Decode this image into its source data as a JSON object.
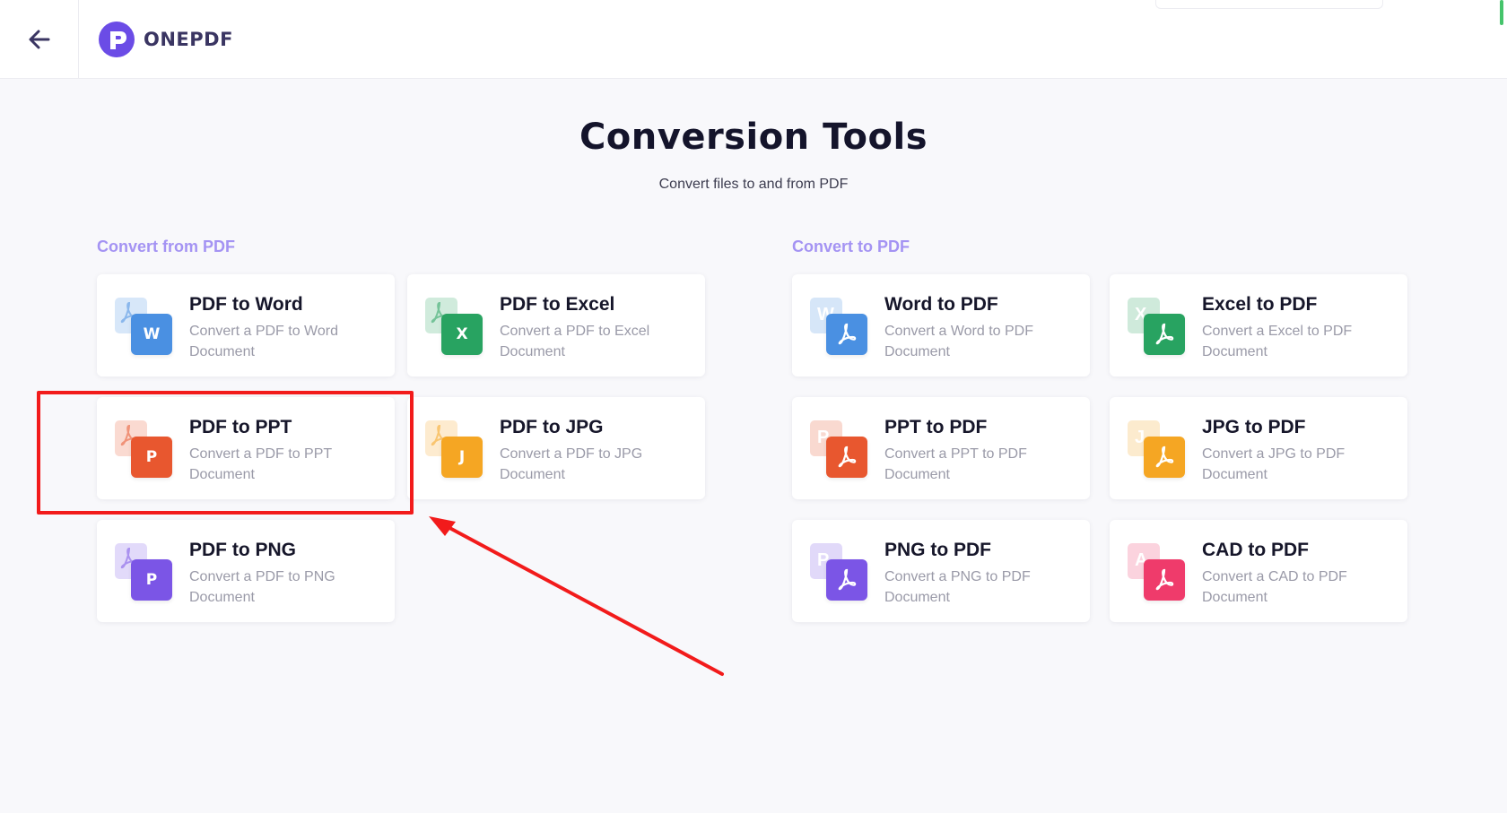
{
  "header": {
    "logo_text": "ONEPDF",
    "brand_color": "#6b4ce6"
  },
  "page": {
    "title": "Conversion Tools",
    "subtitle": "Convert files to and from PDF"
  },
  "sections": {
    "from_pdf": {
      "heading": "Convert from PDF",
      "cards": [
        {
          "title": "PDF to Word",
          "desc": "Convert a PDF to Word Document",
          "glyph": "W",
          "back_icon": "pdf-icon",
          "color": "#4a90e2"
        },
        {
          "title": "PDF to Excel",
          "desc": "Convert a PDF to Excel Document",
          "glyph": "X",
          "back_icon": "pdf-icon",
          "color": "#28a361"
        },
        {
          "title": "PDF to PPT",
          "desc": "Convert a PDF to PPT Document",
          "glyph": "P",
          "back_icon": "pdf-icon",
          "color": "#e8572f"
        },
        {
          "title": "PDF to JPG",
          "desc": "Convert a PDF to JPG Document",
          "glyph": "J",
          "back_icon": "pdf-icon",
          "color": "#f5a623"
        },
        {
          "title": "PDF to PNG",
          "desc": "Convert a PDF to PNG Document",
          "glyph": "P",
          "back_icon": "pdf-icon",
          "color": "#7b55e6"
        }
      ]
    },
    "to_pdf": {
      "heading": "Convert to PDF",
      "cards": [
        {
          "title": "Word to PDF",
          "desc": "Convert a Word to PDF Document",
          "back_glyph": "W",
          "front_icon": "pdf-icon",
          "color": "#4a90e2"
        },
        {
          "title": "Excel to PDF",
          "desc": "Convert a Excel to PDF Document",
          "back_glyph": "X",
          "front_icon": "pdf-icon",
          "color": "#28a361"
        },
        {
          "title": "PPT to PDF",
          "desc": "Convert a PPT to PDF Document",
          "back_glyph": "P",
          "front_icon": "pdf-icon",
          "color": "#e8572f"
        },
        {
          "title": "JPG to PDF",
          "desc": "Convert a JPG to PDF Document",
          "back_glyph": "J",
          "front_icon": "pdf-icon",
          "color": "#f5a623"
        },
        {
          "title": "PNG to PDF",
          "desc": "Convert a PNG to PDF Document",
          "back_glyph": "P",
          "front_icon": "pdf-icon",
          "color": "#7b55e6"
        },
        {
          "title": "CAD to PDF",
          "desc": "Convert a CAD to PDF Document",
          "back_glyph": "A",
          "front_icon": "pdf-icon",
          "color": "#ef3b6b"
        }
      ]
    }
  },
  "annotation": {
    "highlight_color": "#f21b1b",
    "highlighted_card": "PDF to PPT"
  }
}
